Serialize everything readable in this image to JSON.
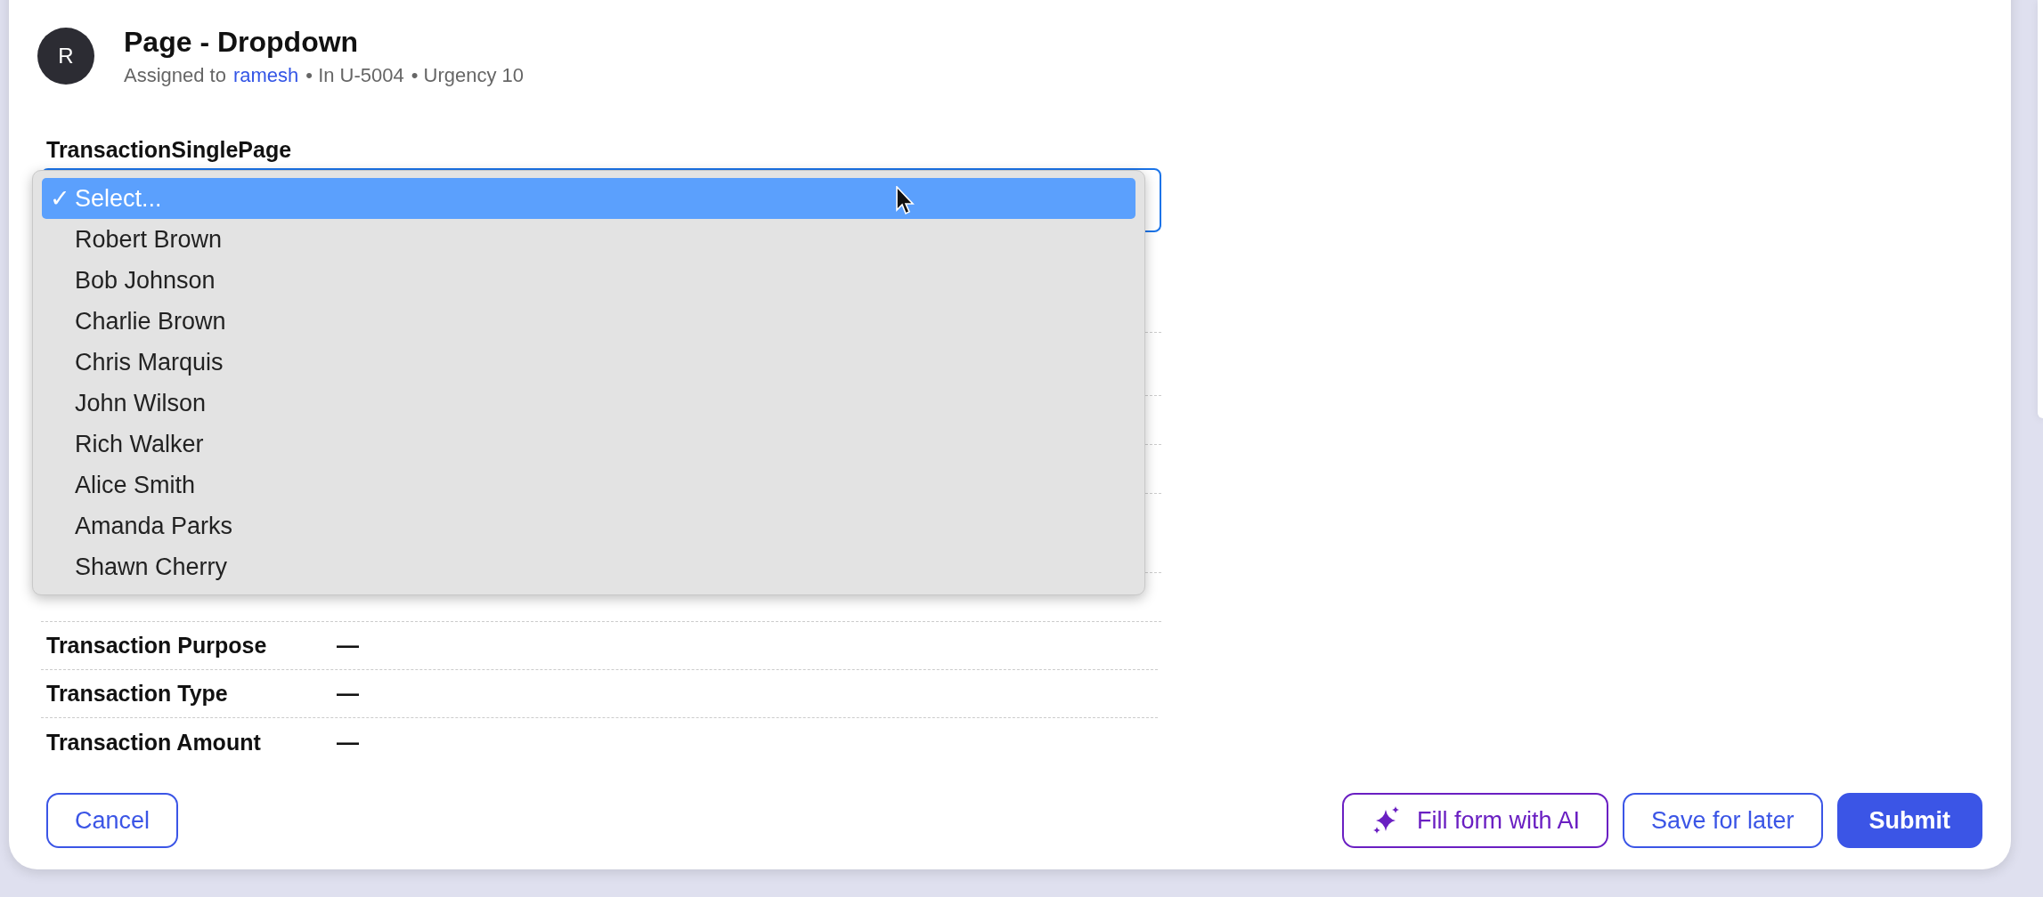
{
  "header": {
    "avatar": "R",
    "title": "Page - Dropdown",
    "assigned_prefix": "Assigned to",
    "assignee": "ramesh",
    "location": "• In U-5004",
    "urgency": "• Urgency 10"
  },
  "field": {
    "label": "TransactionSinglePage",
    "check_mark": "✓",
    "options": [
      {
        "label": "Select...",
        "selected": true
      },
      {
        "label": "Robert Brown",
        "selected": false
      },
      {
        "label": "Bob Johnson",
        "selected": false
      },
      {
        "label": "Charlie Brown",
        "selected": false
      },
      {
        "label": "Chris Marquis",
        "selected": false
      },
      {
        "label": "John Wilson",
        "selected": false
      },
      {
        "label": "Rich Walker",
        "selected": false
      },
      {
        "label": "Alice Smith",
        "selected": false
      },
      {
        "label": "Amanda Parks",
        "selected": false
      },
      {
        "label": "Shawn Cherry",
        "selected": false
      }
    ]
  },
  "details": [
    {
      "label": "Transaction Purpose",
      "value": "—"
    },
    {
      "label": "Transaction Type",
      "value": "—"
    },
    {
      "label": "Transaction Amount",
      "value": "—"
    }
  ],
  "buttons": [
    {
      "kind": "outline",
      "label": "Cancel"
    },
    {
      "kind": "ai",
      "label": "Fill form with AI"
    },
    {
      "kind": "outline",
      "label": "Save for later"
    },
    {
      "kind": "primary",
      "label": "Submit"
    }
  ]
}
